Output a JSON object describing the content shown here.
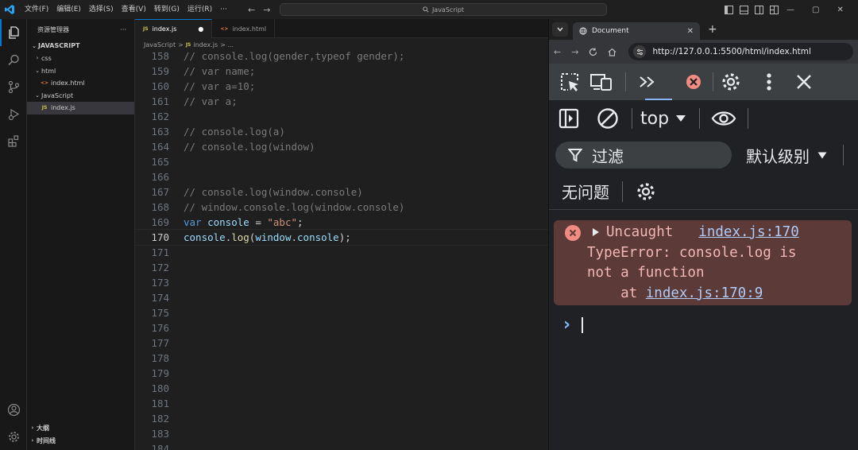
{
  "titlebar": {
    "menu": [
      "文件(F)",
      "编辑(E)",
      "选择(S)",
      "查看(V)",
      "转到(G)",
      "运行(R)",
      "···"
    ],
    "search_text": "JavaScript",
    "back_icon": "arrow-left-icon",
    "forward_icon": "arrow-right-icon"
  },
  "activity": {
    "items": [
      "explorer-icon",
      "search-icon",
      "source-control-icon",
      "run-debug-icon",
      "extensions-icon"
    ],
    "bottom": [
      "account-icon",
      "manage-gear-icon"
    ]
  },
  "sidebar": {
    "header": "资源管理器",
    "more": "···",
    "root": "JAVASCRIPT",
    "tree": [
      {
        "label": "css",
        "kind": "folder",
        "depth": 1,
        "expanded": false
      },
      {
        "label": "html",
        "kind": "folder",
        "depth": 1,
        "expanded": true
      },
      {
        "label": "index.html",
        "kind": "html",
        "depth": 2
      },
      {
        "label": "JavaScript",
        "kind": "folder",
        "depth": 1,
        "expanded": true
      },
      {
        "label": "index.js",
        "kind": "js",
        "depth": 2,
        "selected": true
      }
    ],
    "outline": "大纲",
    "timeline": "时间线"
  },
  "editor": {
    "tabs": [
      {
        "badge": "JS",
        "label": "index.js",
        "modified": "●",
        "active": true
      },
      {
        "badge": "<>",
        "label": "index.html",
        "active": false
      }
    ],
    "breadcrumb": {
      "folder": "JavaScript",
      "sep": ">",
      "badge": "JS",
      "file": "index.js",
      "tail": "> ..."
    },
    "current_line": 170,
    "lines": [
      {
        "n": "158",
        "code": "// console.log(gender,typeof gender);"
      },
      {
        "n": "159",
        "code": "// var name;"
      },
      {
        "n": "160",
        "code": "// var a=10;"
      },
      {
        "n": "161",
        "code": "// var a;"
      },
      {
        "n": "162",
        "code": ""
      },
      {
        "n": "163",
        "code": "// console.log(a)"
      },
      {
        "n": "164",
        "code": "// console.log(window)"
      },
      {
        "n": "165",
        "code": ""
      },
      {
        "n": "166",
        "code": ""
      },
      {
        "n": "167",
        "code": "// console.log(window.console)"
      },
      {
        "n": "168",
        "code": "// window.console.log(window.console)"
      },
      {
        "n": "169",
        "code": "var console = \"abc\";"
      },
      {
        "n": "170",
        "code": "console.log(window.console);"
      },
      {
        "n": "171",
        "code": ""
      },
      {
        "n": "172",
        "code": ""
      },
      {
        "n": "173",
        "code": ""
      },
      {
        "n": "174",
        "code": ""
      },
      {
        "n": "175",
        "code": ""
      },
      {
        "n": "176",
        "code": ""
      },
      {
        "n": "177",
        "code": ""
      },
      {
        "n": "178",
        "code": ""
      },
      {
        "n": "179",
        "code": ""
      },
      {
        "n": "180",
        "code": ""
      },
      {
        "n": "181",
        "code": ""
      },
      {
        "n": "182",
        "code": ""
      },
      {
        "n": "183",
        "code": ""
      },
      {
        "n": "184",
        "code": ""
      }
    ]
  },
  "browser": {
    "tab_title": "Document",
    "url": "http://127.0.0.1:5500/html/index.html",
    "devtools": {
      "context": "top",
      "filter_placeholder": "过滤",
      "levels": "默认级别",
      "issues": "无问题",
      "error": {
        "uncaught": "Uncaught",
        "source": "index.js:170",
        "line2": "TypeError: console.log is",
        "line3": "not a function",
        "at": "    at ",
        "at_link": "index.js:170:9"
      },
      "prompt": "›"
    }
  },
  "colors": {
    "accent": "#0078d4",
    "error_bg": "#5b3a37",
    "error_text": "#f2b8b5",
    "link": "#aecbfa",
    "error_icon": "#f28b82"
  }
}
